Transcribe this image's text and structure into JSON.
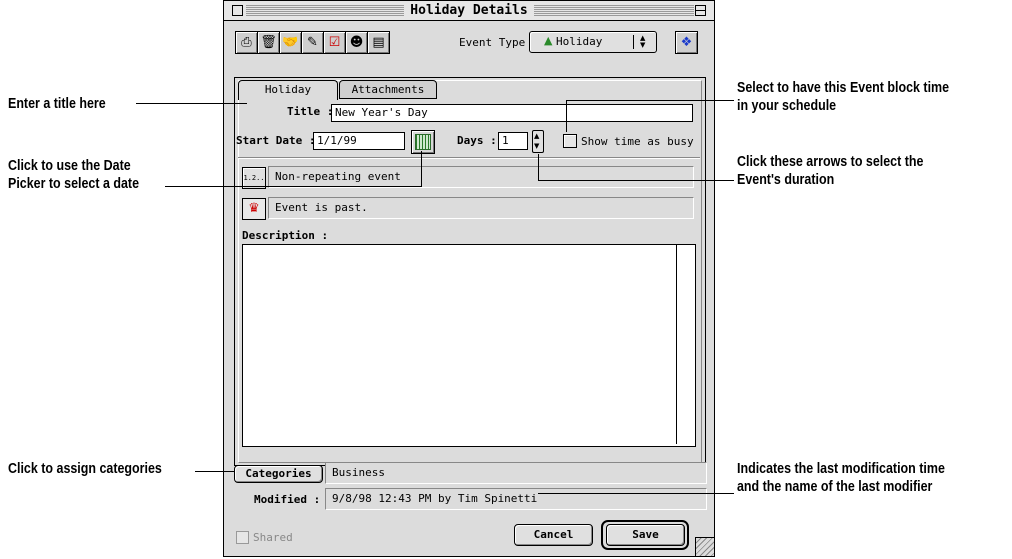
{
  "window": {
    "title": "Holiday Details"
  },
  "toolbar": {
    "icons": [
      "printer-icon",
      "trash-icon",
      "handshake-icon",
      "pencil-tag-icon",
      "checkmark-icon",
      "contact-icon",
      "note-icon"
    ],
    "event_type_label": "Event Type :",
    "event_type_value": "Holiday",
    "help_icon": "help-diamond-icon"
  },
  "tabs": [
    {
      "label": "Holiday"
    },
    {
      "label": "Attachments"
    }
  ],
  "form": {
    "title_label": "Title :",
    "title_value": "New Year's Day",
    "start_date_label": "Start Date :",
    "start_date_value": "1/1/99",
    "days_label": "Days :",
    "days_value": "1",
    "busy_label": "Show time as busy",
    "repeat_button": "1.2..",
    "repeat_text": "Non-repeating event",
    "status_text": "Event is past.",
    "description_label": "Description :",
    "description_value": ""
  },
  "footer": {
    "categories_button": "Categories",
    "categories_value": "Business",
    "modified_label": "Modified :",
    "modified_value": "9/8/98 12:43 PM by Tim Spinetti",
    "shared_label": "Shared",
    "cancel_button": "Cancel",
    "save_button": "Save"
  },
  "callouts": {
    "title": "Enter a title here",
    "date_picker_1": "Click to use the Date",
    "date_picker_2": "Picker to select a date",
    "categories": "Click to assign categories",
    "busy_1": "Select to have this Event block time",
    "busy_2": "in your schedule",
    "arrows_1": "Click these arrows to select the",
    "arrows_2": "Event's duration",
    "modified_1": "Indicates the last modification time",
    "modified_2": "and the name of the last modifier"
  }
}
